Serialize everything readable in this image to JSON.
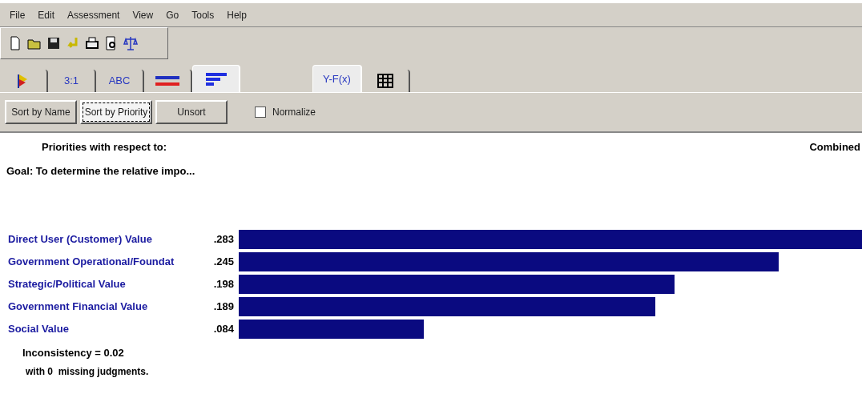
{
  "menu": [
    "File",
    "Edit",
    "Assessment",
    "View",
    "Go",
    "Tools",
    "Help"
  ],
  "toolbar": [
    {
      "kind": "new"
    },
    {
      "kind": "open"
    },
    {
      "kind": "save"
    },
    {
      "kind": "undo"
    },
    {
      "kind": "print"
    },
    {
      "kind": "preview"
    },
    {
      "kind": "scale"
    }
  ],
  "tabs_left": [
    {
      "kind": "flag",
      "selected": false
    },
    {
      "kind": "text",
      "label": "3:1",
      "selected": false
    },
    {
      "kind": "text",
      "label": "ABC",
      "selected": false
    },
    {
      "kind": "bars",
      "selected": false
    },
    {
      "kind": "ranking",
      "selected": true
    }
  ],
  "tabs_right": [
    {
      "kind": "text",
      "label": "Y-F(x)",
      "selected": true
    },
    {
      "kind": "grid",
      "selected": false
    }
  ],
  "buttons": [
    {
      "label": "Sort by Name",
      "selected": false
    },
    {
      "label": "Sort by Priority",
      "selected": true
    },
    {
      "label": "Unsort",
      "selected": false
    }
  ],
  "normalize": {
    "label": "Normalize",
    "checked": false
  },
  "header": {
    "title": "Priorities with respect to:",
    "goal": "Goal: To determine the relative impo...",
    "mode": "Combined"
  },
  "priorities": [
    {
      "name": "Direct User (Customer) Value",
      "value": ".283"
    },
    {
      "name": "Government Operational/Foundat",
      "value": ".245"
    },
    {
      "name": "Strategic/Political Value",
      "value": ".198"
    },
    {
      "name": "Government Financial Value",
      "value": ".189"
    },
    {
      "name": "Social Value",
      "value": ".084"
    }
  ],
  "footer": {
    "inconsistency": "Inconsistency = 0.02",
    "missing": "with 0  missing judgments."
  }
}
